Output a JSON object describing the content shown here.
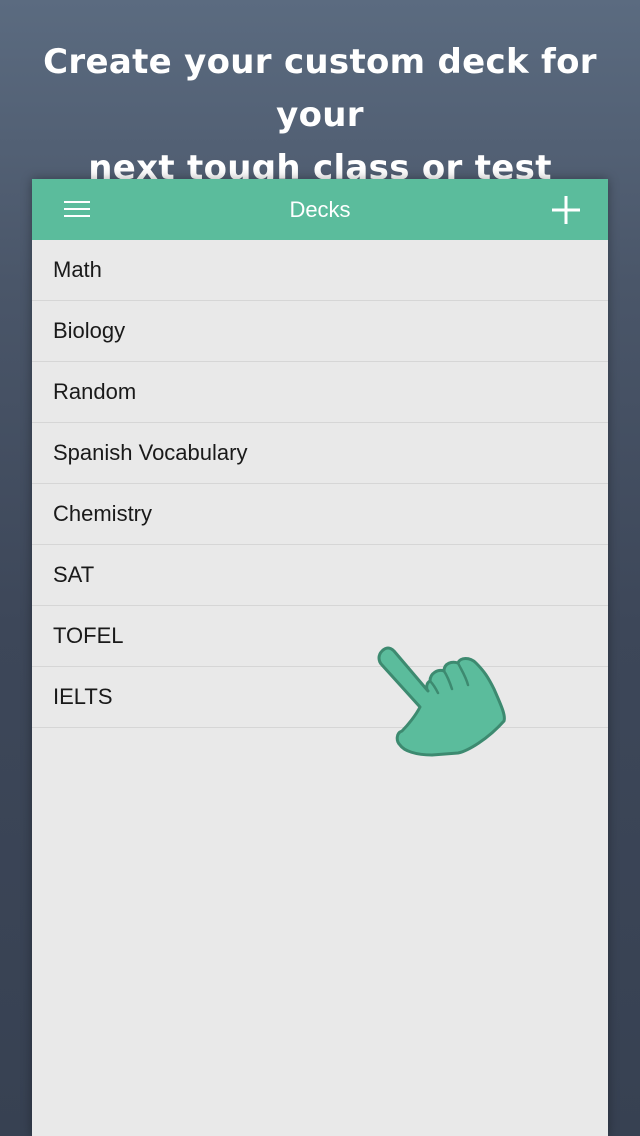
{
  "headline": {
    "line1": "Create your custom deck for your",
    "line2": "next tough class or test"
  },
  "navbar": {
    "title": "Decks",
    "menu_icon": "hamburger-menu-icon",
    "add_icon": "plus-icon",
    "color": "#5bbc9c"
  },
  "decks": [
    {
      "label": "Math"
    },
    {
      "label": "Biology"
    },
    {
      "label": "Random"
    },
    {
      "label": "Spanish Vocabulary"
    },
    {
      "label": "Chemistry"
    },
    {
      "label": "SAT"
    },
    {
      "label": "TOFEL"
    },
    {
      "label": "IELTS"
    }
  ],
  "pointer_icon": "pointing-hand-icon"
}
